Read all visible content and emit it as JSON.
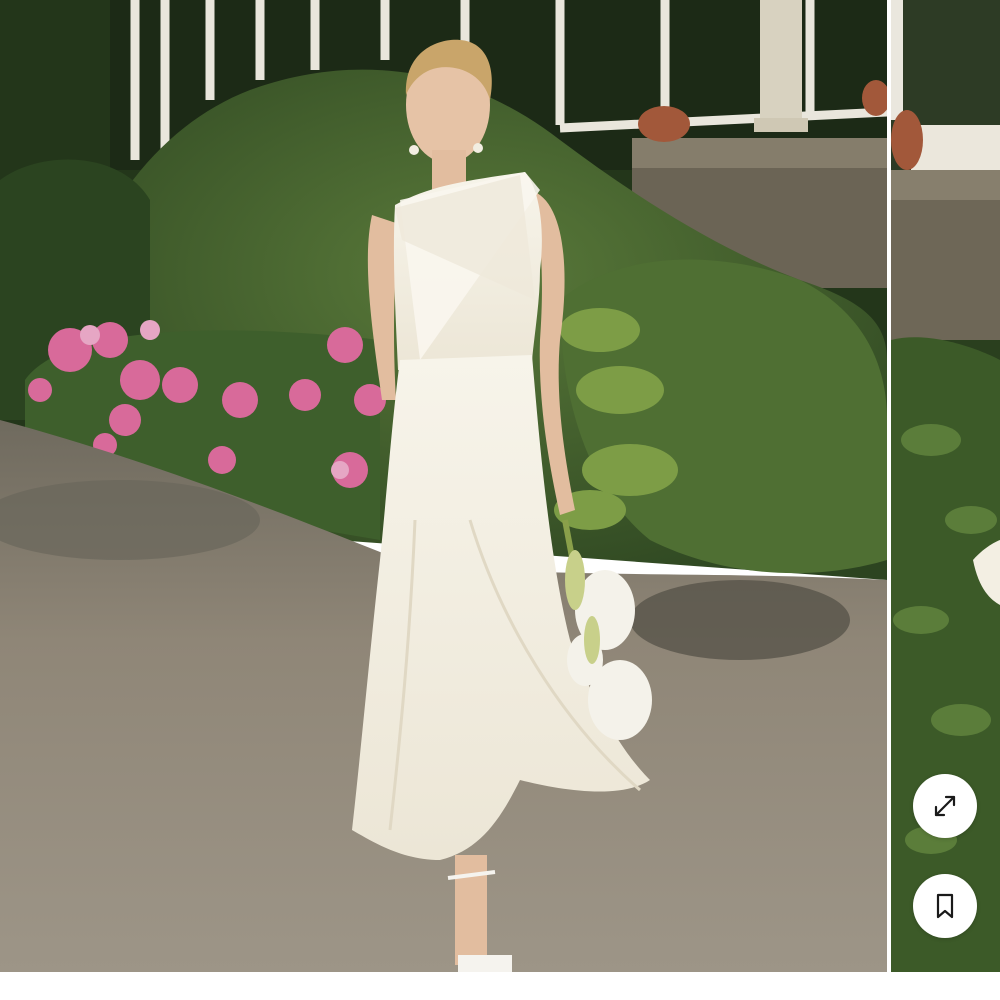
{
  "gallery": {
    "main_image": {
      "subject": "woman-in-white-halter-midi-dress",
      "setting": "garden-with-hydrangeas-and-hedge"
    },
    "next_image": {
      "subject": "garden-hedge-partial"
    },
    "actions": {
      "expand_icon": "expand-arrows-icon",
      "save_icon": "bookmark-icon"
    }
  },
  "colors": {
    "hedge_dark": "#2f4a22",
    "hedge_mid": "#4f6f33",
    "hydrangea_pink": "#d86a9a",
    "ground": "#8f8677",
    "dress": "#f3efe3",
    "window_frame": "#e9e6dc",
    "button_bg": "#ffffff",
    "icon_stroke": "#1a1a1a"
  }
}
